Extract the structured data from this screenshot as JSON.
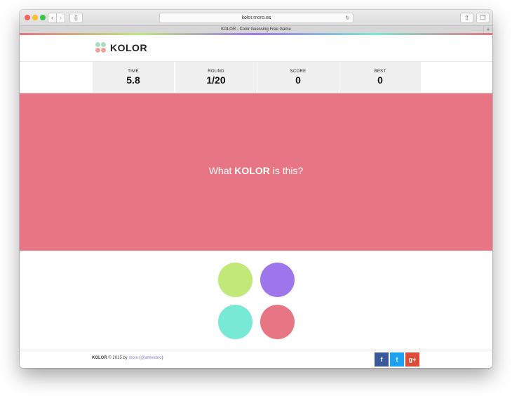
{
  "browser": {
    "url": "kolor.moro.es",
    "tab_title": "KOLOR - Color Guessing Free Game",
    "back_glyph": "‹",
    "forward_glyph": "›",
    "sidebar_glyph": "▯",
    "reload_glyph": "↻",
    "share_glyph": "⇧",
    "tabs_glyph": "❐",
    "new_tab_glyph": "+"
  },
  "header": {
    "brand": "KOLOR"
  },
  "stats": [
    {
      "label": "TIME",
      "value": "5.8"
    },
    {
      "label": "ROUND",
      "value": "1/20"
    },
    {
      "label": "SCORE",
      "value": "0"
    },
    {
      "label": "BEST",
      "value": "0"
    }
  ],
  "game": {
    "target_color": "#e87583",
    "question_prefix": "What ",
    "question_brand": "KOLOR",
    "question_suffix": " is this?",
    "choices": [
      {
        "color": "#c0e977"
      },
      {
        "color": "#9e76ec"
      },
      {
        "color": "#78e9d4"
      },
      {
        "color": "#e87583"
      }
    ]
  },
  "footer": {
    "brand": "KOLOR",
    "copyright": " © 2015 by ",
    "author": "moro",
    "open_paren": " (",
    "handle": "@alterebro",
    "close_paren": ")",
    "social": [
      {
        "name": "facebook",
        "glyph": "f",
        "color": "#3b5998"
      },
      {
        "name": "twitter",
        "glyph": "t",
        "color": "#1da1f2"
      },
      {
        "name": "google-plus",
        "glyph": "g+",
        "color": "#dd4b39"
      }
    ]
  }
}
